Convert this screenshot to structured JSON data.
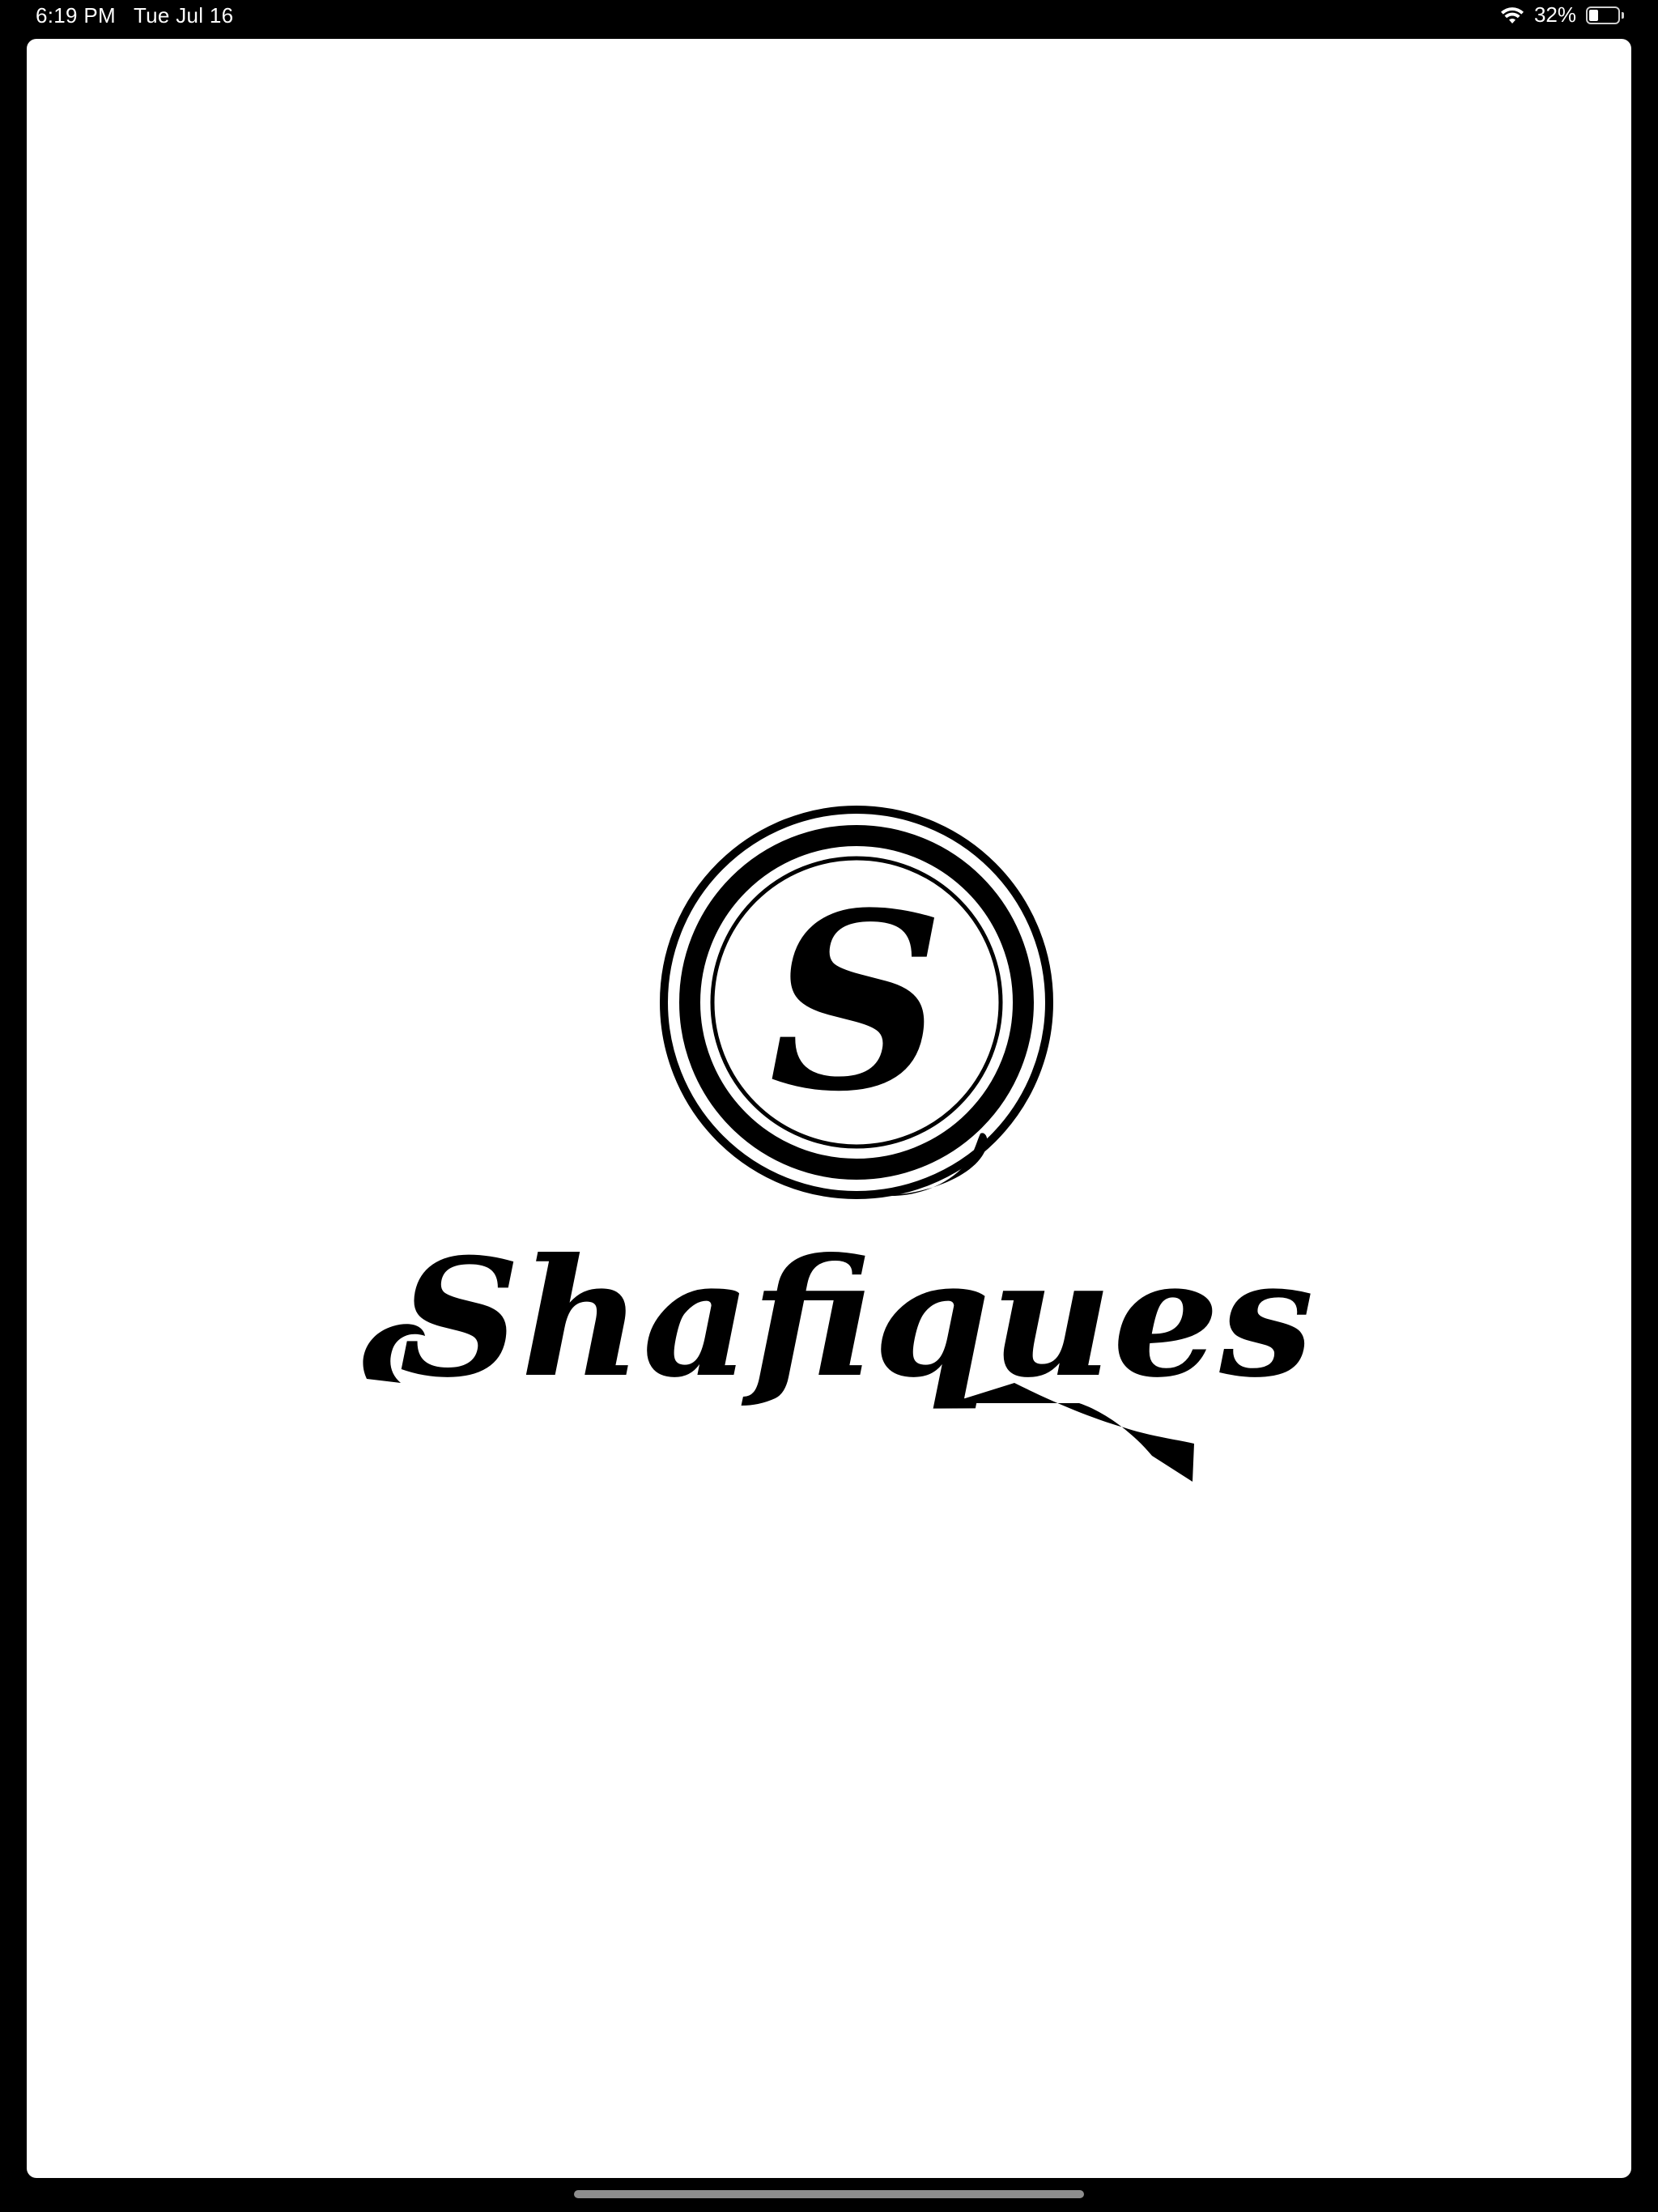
{
  "status_bar": {
    "time": "6:19 PM",
    "date": "Tue Jul 16",
    "battery_percent_label": "32%",
    "battery_level": 0.32,
    "icons": [
      "wifi-icon",
      "battery-icon"
    ]
  },
  "splash": {
    "brand_name": "Shafiques",
    "monogram": "S"
  },
  "colors": {
    "screen_background": "#ffffff",
    "logo": "#000000",
    "device_frame": "#000000"
  }
}
